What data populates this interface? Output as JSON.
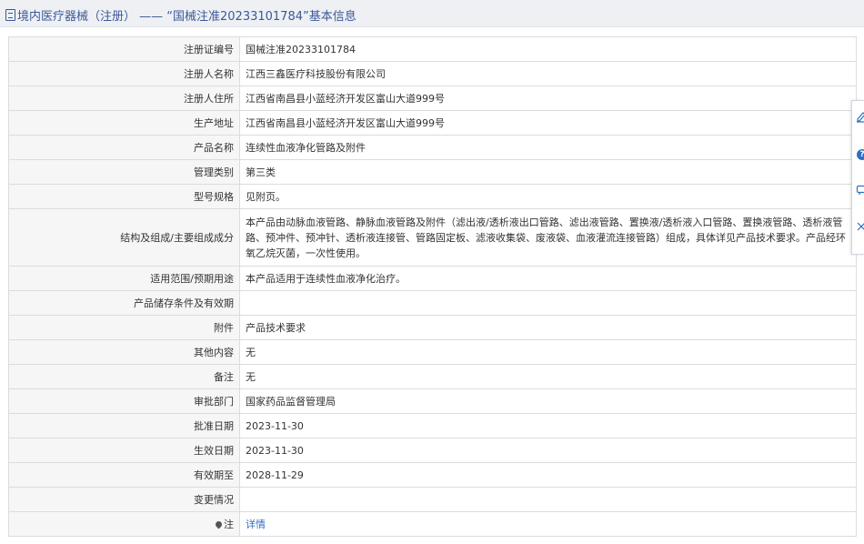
{
  "header": {
    "title": "境内医疗器械（注册） —— “国械注准20233101784”基本信息"
  },
  "rows": [
    {
      "label": "注册证编号",
      "value": "国械注准20233101784"
    },
    {
      "label": "注册人名称",
      "value": "江西三鑫医疗科技股份有限公司"
    },
    {
      "label": "注册人住所",
      "value": "江西省南昌县小蓝经济开发区富山大道999号"
    },
    {
      "label": "生产地址",
      "value": "江西省南昌县小蓝经济开发区富山大道999号"
    },
    {
      "label": "产品名称",
      "value": "连续性血液净化管路及附件"
    },
    {
      "label": "管理类别",
      "value": "第三类"
    },
    {
      "label": "型号规格",
      "value": "见附页。"
    },
    {
      "label": "结构及组成/主要组成成分",
      "value": "本产品由动脉血液管路、静脉血液管路及附件（滤出液/透析液出口管路、滤出液管路、置换液/透析液入口管路、置换液管路、透析液管路、预冲件、预冲针、透析液连接管、管路固定板、滤液收集袋、废液袋、血液灌流连接管路）组成，具体详见产品技术要求。产品经环氧乙烷灭菌，一次性使用。"
    },
    {
      "label": "适用范围/预期用途",
      "value": "本产品适用于连续性血液净化治疗。"
    },
    {
      "label": "产品储存条件及有效期",
      "value": ""
    },
    {
      "label": "附件",
      "value": "产品技术要求"
    },
    {
      "label": "其他内容",
      "value": "无"
    },
    {
      "label": "备注",
      "value": "无"
    },
    {
      "label": "审批部门",
      "value": "国家药品监督管理局"
    },
    {
      "label": "批准日期",
      "value": "2023-11-30"
    },
    {
      "label": "生效日期",
      "value": "2023-11-30"
    },
    {
      "label": "有效期至",
      "value": "2028-11-29"
    },
    {
      "label": "变更情况",
      "value": ""
    }
  ],
  "note_row": {
    "label": "注",
    "link": "详情"
  },
  "toolbar": {
    "help_glyph": "?"
  },
  "colors": {
    "link": "#2f6fc1",
    "header_bg": "#eef0f4",
    "label_bg": "#f6f6f6"
  }
}
